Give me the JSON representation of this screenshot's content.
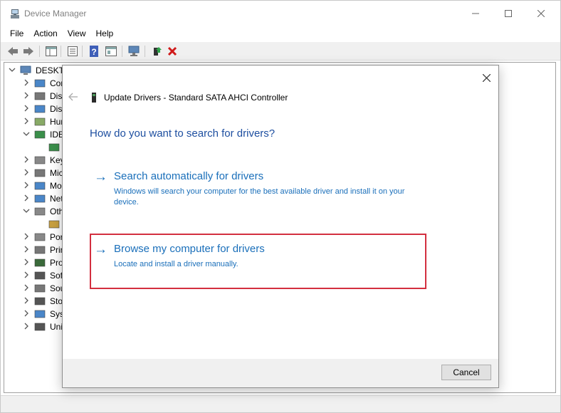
{
  "window": {
    "title": "Device Manager"
  },
  "menu": [
    "File",
    "Action",
    "View",
    "Help"
  ],
  "toolbar": {
    "icons": [
      "back-icon",
      "forward-icon",
      "show-hide-tree-icon",
      "properties-icon",
      "help-icon",
      "view-icon",
      "scan-hardware-icon",
      "update-driver-icon",
      "uninstall-icon"
    ]
  },
  "tree": {
    "root": "DESKTO",
    "items": [
      {
        "label": "Cor",
        "expanded": false
      },
      {
        "label": "Disl",
        "expanded": false
      },
      {
        "label": "Disp",
        "expanded": false
      },
      {
        "label": "Hur",
        "expanded": false
      },
      {
        "label": "IDE",
        "expanded": true
      },
      {
        "label": "",
        "child": true
      },
      {
        "label": "Key",
        "expanded": false
      },
      {
        "label": "Mic",
        "expanded": false
      },
      {
        "label": "Mo",
        "expanded": false
      },
      {
        "label": "Net",
        "expanded": false
      },
      {
        "label": "Oth",
        "expanded": true
      },
      {
        "label": "",
        "child": true
      },
      {
        "label": "Por",
        "expanded": false
      },
      {
        "label": "Prir",
        "expanded": false
      },
      {
        "label": "Pro",
        "expanded": false
      },
      {
        "label": "Sof",
        "expanded": false
      },
      {
        "label": "Sou",
        "expanded": false
      },
      {
        "label": "Sto",
        "expanded": false
      },
      {
        "label": "Syst",
        "expanded": false
      },
      {
        "label": "Uni",
        "expanded": false
      }
    ]
  },
  "dialog": {
    "header": "Update Drivers - Standard SATA AHCI Controller",
    "question": "How do you want to search for drivers?",
    "search_option": {
      "title": "Search automatically for drivers",
      "description": "Windows will search your computer for the best available driver and install it on your device."
    },
    "browse_option": {
      "title": "Browse my computer for drivers",
      "description": "Locate and install a driver manually."
    },
    "cancel_label": "Cancel"
  },
  "colors": {
    "accent": "#1a6fba",
    "question": "#1e4fa0",
    "highlight": "#d32f3f"
  }
}
